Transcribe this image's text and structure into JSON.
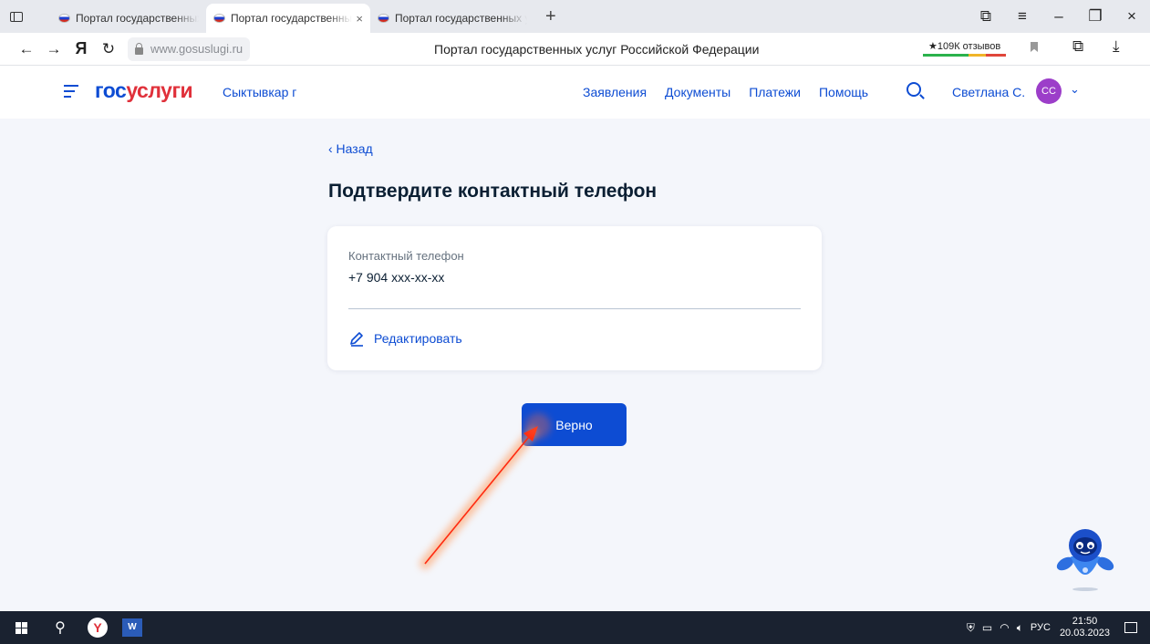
{
  "browser": {
    "tabs": [
      {
        "label": "Портал государственных у"
      },
      {
        "label": "Портал государственны"
      },
      {
        "label": "Портал государственных у"
      }
    ],
    "tab_close": "×",
    "new_tab": "+",
    "url": "www.gosuslugi.ru",
    "page_title": "Портал государственных услуг Российской Федерации",
    "reviews_badge": "★109К отзывов",
    "yandex_letter": "Я",
    "window_controls": {
      "minimize": "–",
      "maximize": "❐",
      "close": "×"
    }
  },
  "header": {
    "logo_part1": "гос",
    "logo_part2": "услуги",
    "region": "Сыктывкар г",
    "nav": [
      "Заявления",
      "Документы",
      "Платежи",
      "Помощь"
    ],
    "user_name": "Светлана С.",
    "avatar_initials": "СС"
  },
  "main": {
    "back_label": "‹ Назад",
    "title": "Подтвердите контактный телефон",
    "card": {
      "label": "Контактный телефон",
      "value": "+7 904 ххх-хх-хх",
      "edit_label": "Редактировать"
    },
    "confirm_button": "Верно"
  },
  "taskbar": {
    "lang": "РУС",
    "time": "21:50",
    "date": "20.03.2023",
    "word_icon": "W"
  },
  "colors": {
    "brand_blue": "#0d4cd3",
    "brand_red": "#e0303a",
    "avatar_purple": "#9c3ec9",
    "annotation_arrow": "#ff3b1a"
  }
}
